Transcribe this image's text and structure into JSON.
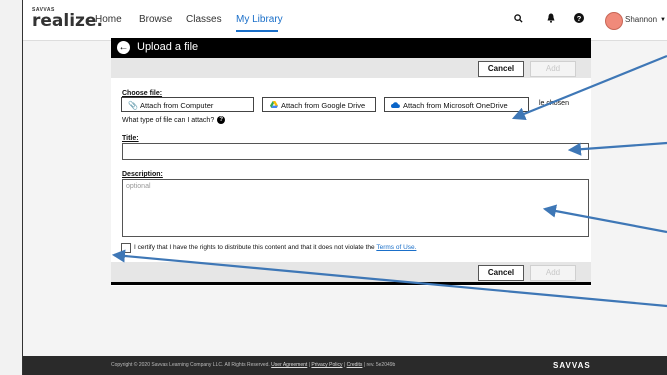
{
  "brand": {
    "small": "SAVVAS",
    "name": "realize."
  },
  "nav": {
    "items": [
      "Home",
      "Browse",
      "Classes",
      "My Library"
    ]
  },
  "user": {
    "name": "Shannon"
  },
  "dialog": {
    "title": "Upload a file",
    "cancel_label": "Cancel",
    "add_label": "Add",
    "choose_file_label": "Choose file:",
    "attach_computer": "Attach from Computer",
    "attach_drive": "Attach from Google Drive",
    "attach_onedrive": "Attach from Microsoft OneDrive",
    "no_file_text": "le chosen",
    "file_type_help": "What type of file can I attach?",
    "title_label": "Title:",
    "title_value": "",
    "description_label": "Description:",
    "description_placeholder": "optional",
    "certify_text": "I certify that I have the rights to distribute this content and that it does not violate the",
    "terms_link": "Terms of Use."
  },
  "footer": {
    "copyright": "Copyright © 2020 Savvas Learning Company LLC. All Rights Reserved.",
    "user_agreement": "User Agreement",
    "privacy_policy": "Privacy Policy",
    "credits": "Credits",
    "rev": "rev. 5e2049b",
    "logo": "SAVVAS"
  },
  "colors": {
    "accent": "#1a6fc9",
    "annotation_arrow": "#3e77b6",
    "header_bg": "#000000"
  }
}
